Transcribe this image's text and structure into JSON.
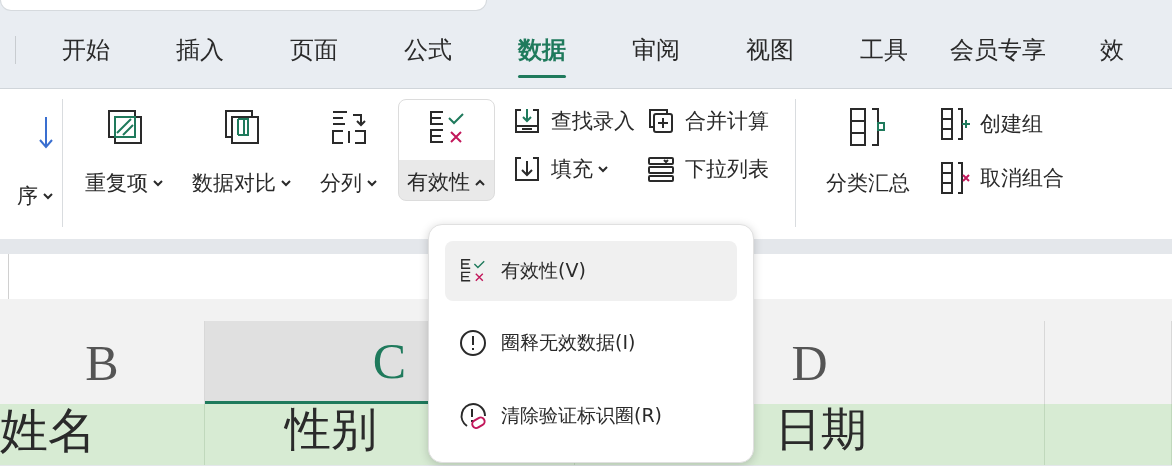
{
  "tabs": [
    {
      "label": "开始",
      "selected": false
    },
    {
      "label": "插入",
      "selected": false
    },
    {
      "label": "页面",
      "selected": false
    },
    {
      "label": "公式",
      "selected": false
    },
    {
      "label": "数据",
      "selected": true
    },
    {
      "label": "审阅",
      "selected": false
    },
    {
      "label": "视图",
      "selected": false
    },
    {
      "label": "工具",
      "selected": false
    },
    {
      "label": "会员专享",
      "selected": false
    },
    {
      "label": "效",
      "selected": false
    }
  ],
  "ribbon": {
    "cut_button": {
      "label": "序"
    },
    "large_buttons": [
      {
        "label": "重复项",
        "expanded": false
      },
      {
        "label": "数据对比",
        "expanded": false
      },
      {
        "label": "分列",
        "expanded": false
      },
      {
        "label": "有效性",
        "expanded": true
      }
    ],
    "small_buttons": [
      {
        "label": "查找录入",
        "caret": false
      },
      {
        "label": "填充",
        "caret": true
      },
      {
        "label": "合并计算",
        "caret": false
      },
      {
        "label": "下拉列表",
        "caret": false
      }
    ],
    "outline_button": {
      "label": "分类汇总"
    },
    "group_buttons": [
      {
        "label": "创建组"
      },
      {
        "label": "取消组合"
      }
    ]
  },
  "menu": {
    "items": [
      {
        "label": "有效性(V)",
        "selected": true
      },
      {
        "label": "圈释无效数据(I)",
        "selected": false
      },
      {
        "label": "清除验证标识圈(R)",
        "selected": false
      }
    ]
  },
  "sheet": {
    "columns": [
      {
        "label": "B",
        "selected": false
      },
      {
        "label": "C",
        "selected": true
      },
      {
        "label": "D",
        "selected": false
      }
    ],
    "row": [
      "姓名",
      "性别",
      "日期"
    ]
  }
}
